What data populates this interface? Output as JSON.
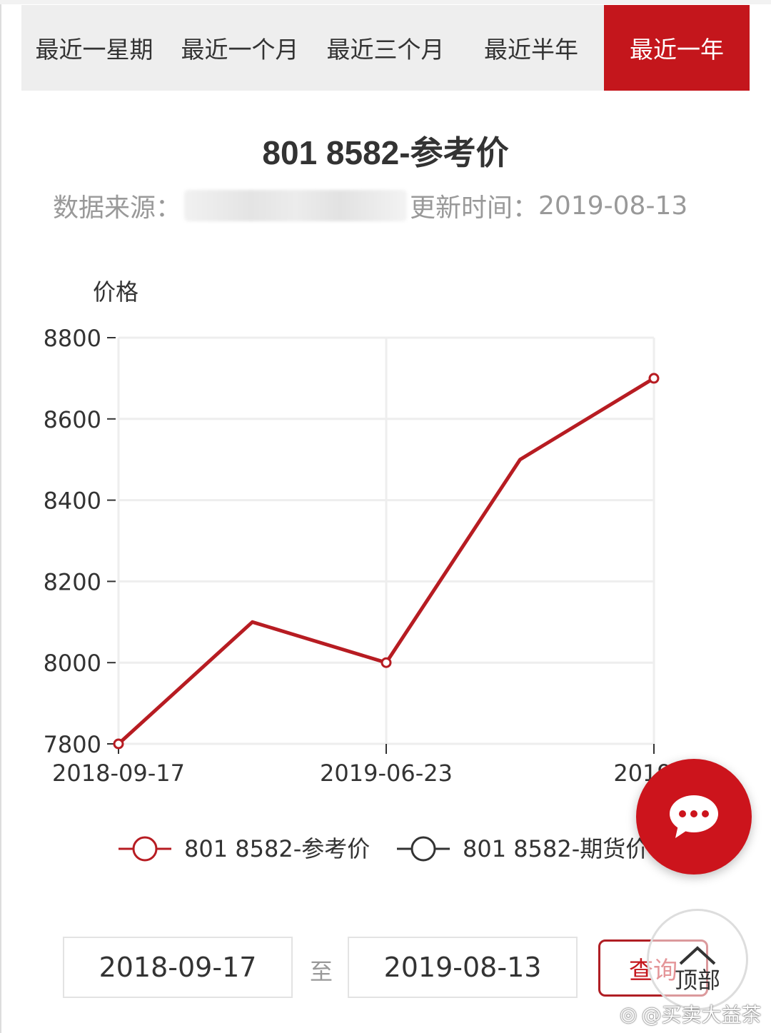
{
  "tabs": [
    {
      "label": "最近一星期",
      "active": false
    },
    {
      "label": "最近一个月",
      "active": false
    },
    {
      "label": "最近三个月",
      "active": false
    },
    {
      "label": "最近半年",
      "active": false
    },
    {
      "label": "最近一年",
      "active": true
    }
  ],
  "header": {
    "title": "801 8582-参考价",
    "source_label": "数据来源：",
    "update_label": "更新时间：",
    "update_date": "2019-08-13"
  },
  "colors": {
    "accent": "#c4161c",
    "series_ref": "#b71c22",
    "series_futures": "#333333",
    "grid": "#eeeeee"
  },
  "chart_data": {
    "type": "line",
    "title": "801 8582-参考价",
    "ylabel": "价格",
    "xlabel": "",
    "ylim": [
      7800,
      8800
    ],
    "yticks": [
      7800,
      8000,
      8200,
      8400,
      8600,
      8800
    ],
    "x": [
      "2018-09-17",
      "",
      "2019-06-23",
      "",
      "2019-08-13"
    ],
    "xtick_labels": [
      "2018-09-17",
      "2019-06-23",
      "2019-0"
    ],
    "grid": true,
    "series": [
      {
        "name": "801 8582-参考价",
        "values": [
          7800,
          8100,
          8000,
          8500,
          8700
        ],
        "markers": [
          true,
          false,
          true,
          false,
          true
        ]
      },
      {
        "name": "801 8582-期货价",
        "values": []
      }
    ],
    "legend": {
      "position": "bottom",
      "items": [
        "801 8582-参考价",
        "801 8582-期货价"
      ]
    }
  },
  "query": {
    "start_date": "2018-09-17",
    "separator": "至",
    "end_date": "2019-08-13",
    "button_label": "查询"
  },
  "floating": {
    "chat_icon": "chat-bubble-icon",
    "top_label": "顶部"
  },
  "watermark": "@买卖大益茶"
}
